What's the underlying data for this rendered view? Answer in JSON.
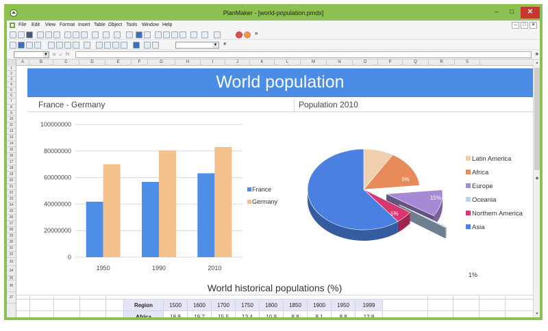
{
  "window": {
    "title": "PlanMaker - [world-population.pmdx]",
    "min_label": "–",
    "max_label": "□",
    "close_label": "✕"
  },
  "menu": {
    "items": [
      "File",
      "Edit",
      "View",
      "Format",
      "Insert",
      "Table",
      "Object",
      "Tools",
      "Window",
      "Help"
    ]
  },
  "toolbar": {
    "overflow_label": "»"
  },
  "formula_bar": {
    "cancel": "✕",
    "confirm": "✓",
    "function": "fx",
    "overflow_label": "»"
  },
  "columns": [
    "A",
    "B",
    "C",
    "D",
    "E",
    "F",
    "G",
    "H",
    "I",
    "J",
    "K",
    "L",
    "M",
    "N",
    "O",
    "P",
    "Q",
    "R",
    "S"
  ],
  "rows": [
    "1",
    "2",
    "3",
    "4",
    "5",
    "6",
    "7",
    "8",
    "9",
    "10",
    "11",
    "12",
    "13",
    "14",
    "15",
    "16",
    "17",
    "18",
    "19",
    "20",
    "21",
    "22",
    "23",
    "24",
    "25",
    "26",
    "27",
    "28",
    "29",
    "30",
    "31",
    "32",
    "33",
    "34",
    "35",
    "36",
    "37"
  ],
  "sheet": {
    "banner_title": "World population",
    "left_heading": "France - Germany",
    "right_heading": "Population 2010",
    "table_title": "World historical populations (%)"
  },
  "bar_chart": {
    "type": "bar",
    "categories": [
      "1950",
      "1990",
      "2010"
    ],
    "series": [
      {
        "name": "France",
        "values": [
          41800000,
          56700000,
          63200000
        ],
        "color": "#4f8ee6"
      },
      {
        "name": "Germany",
        "values": [
          70000000,
          80500000,
          83000000
        ],
        "color": "#f4c08b"
      }
    ],
    "ylim": [
      0,
      100000000
    ],
    "yticks": [
      "0",
      "20000000",
      "40000000",
      "60000000",
      "80000000",
      "100000000"
    ],
    "grid": true,
    "legend_position": "right"
  },
  "pie_chart": {
    "type": "pie",
    "legend": [
      {
        "label": "Latin America",
        "color": "#f0cfae"
      },
      {
        "label": "Africa",
        "color": "#e98a5a"
      },
      {
        "label": "Europe",
        "color": "#a78ad6"
      },
      {
        "label": "Oceania",
        "color": "#b7d3ee"
      },
      {
        "label": "Northern America",
        "color": "#d9356f"
      },
      {
        "label": "Asia",
        "color": "#4a80df"
      }
    ],
    "labels": {
      "africa": "9%",
      "europe": "15%",
      "northern_america": "5%",
      "oceania": "1%"
    }
  },
  "chart_data": [
    {
      "type": "bar",
      "title": "France - Germany",
      "categories": [
        "1950",
        "1990",
        "2010"
      ],
      "series": [
        {
          "name": "France",
          "values": [
            41800000,
            56700000,
            63200000
          ]
        },
        {
          "name": "Germany",
          "values": [
            70000000,
            80500000,
            83000000
          ]
        }
      ],
      "ylim": [
        0,
        100000000
      ],
      "xlabel": "",
      "ylabel": ""
    },
    {
      "type": "pie",
      "title": "Population 2010",
      "categories": [
        "Latin America",
        "Africa",
        "Europe",
        "Oceania",
        "Northern America",
        "Asia"
      ],
      "values": [
        8.6,
        14.8,
        10.7,
        0.5,
        5.0,
        60.4
      ],
      "data_labels": [
        "",
        "9%",
        "15%",
        "1%",
        "5%",
        ""
      ]
    }
  ],
  "table": {
    "header_label": "Region",
    "years": [
      "1500",
      "1600",
      "1700",
      "1750",
      "1800",
      "1850",
      "1900",
      "1950",
      "1999"
    ],
    "rows": [
      {
        "label": "Africa",
        "values": [
          "18.8",
          "19.7",
          "15.5",
          "13.4",
          "10.9",
          "8.8",
          "8.1",
          "8.8",
          "12.8"
        ]
      }
    ]
  }
}
